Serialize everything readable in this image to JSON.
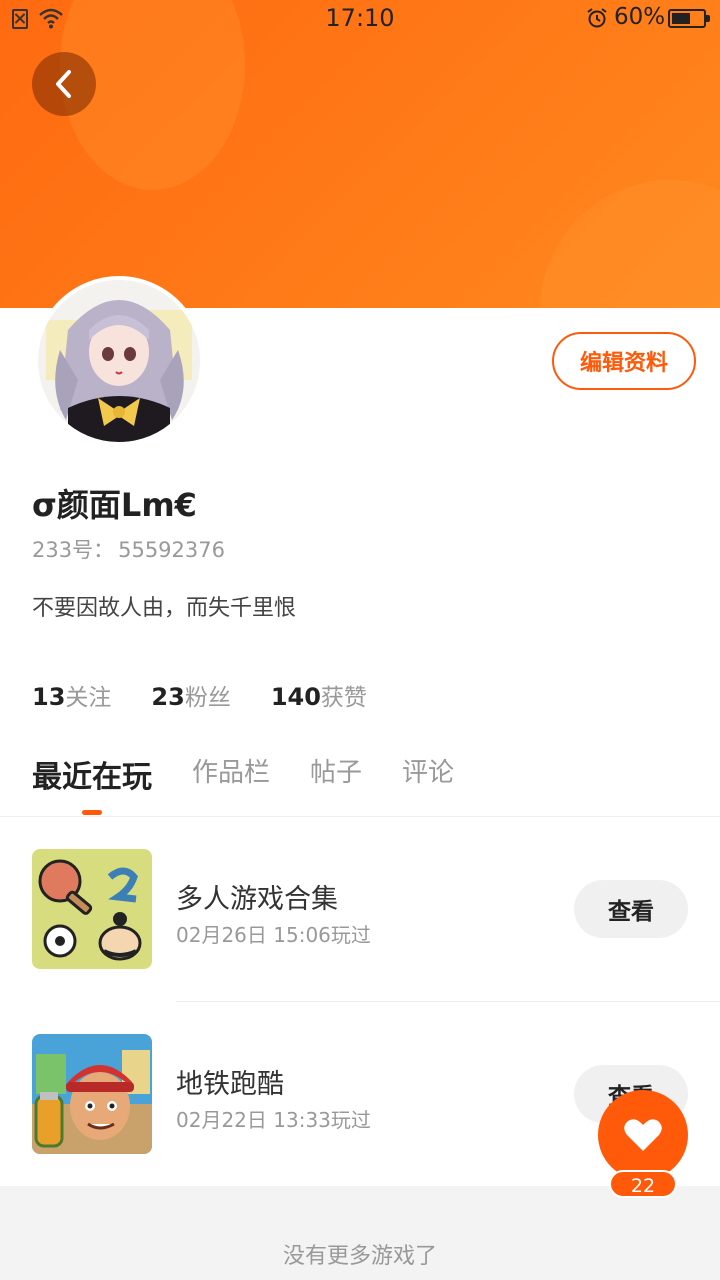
{
  "status_bar": {
    "time": "17:10",
    "battery": "60%",
    "battery_level": 0.6
  },
  "profile": {
    "username": "σ颜面Lm€",
    "id_label": "233号：",
    "id_value": "55592376",
    "bio": "不要因故人由，而失千里恨",
    "edit_label": "编辑资料"
  },
  "stats": [
    {
      "num": "13",
      "label": "关注"
    },
    {
      "num": "23",
      "label": "粉丝"
    },
    {
      "num": "140",
      "label": "获赞"
    }
  ],
  "tabs": [
    {
      "label": "最近在玩",
      "active": true
    },
    {
      "label": "作品栏",
      "active": false
    },
    {
      "label": "帖子",
      "active": false
    },
    {
      "label": "评论",
      "active": false
    }
  ],
  "games": [
    {
      "name": "多人游戏合集",
      "time": "02月26日 15:06玩过",
      "button": "查看"
    },
    {
      "name": "地铁跑酷",
      "time": "02月22日 13:33玩过",
      "button": "查看"
    }
  ],
  "footer": {
    "text": "没有更多游戏了"
  },
  "like": {
    "count": "22"
  },
  "colors": {
    "accent": "#ff5a0a",
    "header": "#ff7a18"
  }
}
